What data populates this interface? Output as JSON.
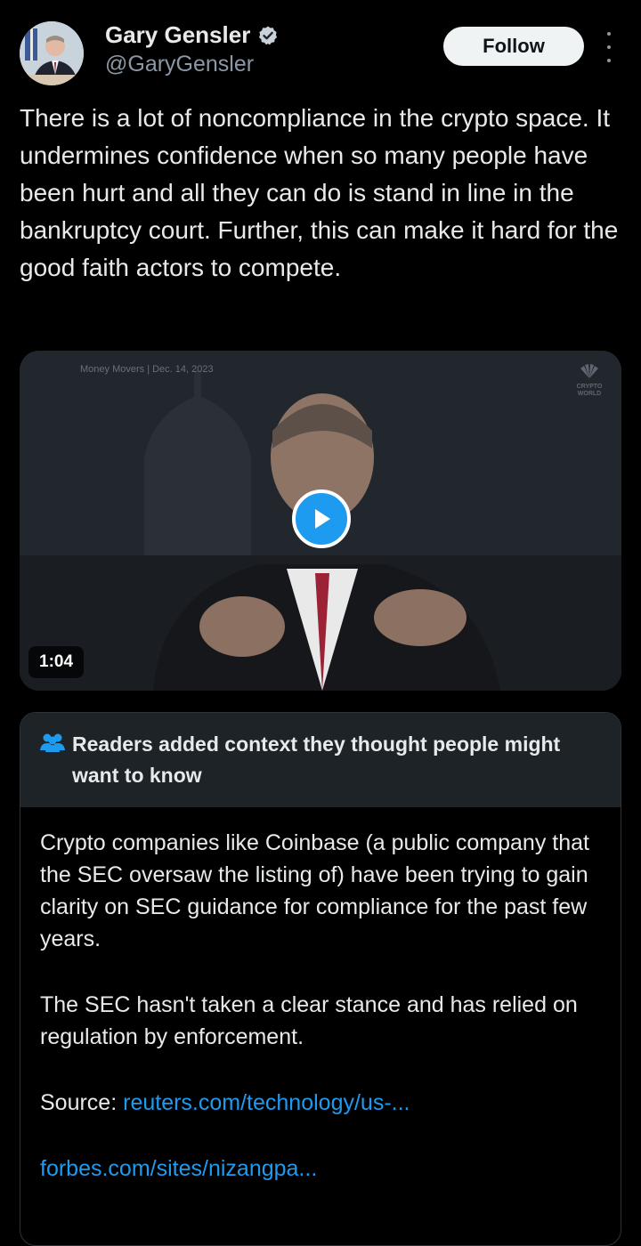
{
  "author": {
    "name": "Gary Gensler",
    "handle": "@GaryGensler",
    "verified_icon": "verified-badge-icon",
    "avatar_icon": "profile-photo"
  },
  "actions": {
    "follow_label": "Follow",
    "more_icon": "more-vertical-icon"
  },
  "tweet": {
    "text": "There is a lot of noncompliance in the crypto space. It undermines confidence when so many people have been hurt and all they can do is stand in line in the bankruptcy court. Further, this can make it hard for the good faith actors to compete."
  },
  "video": {
    "overlay_label": "Money Movers | Dec. 14, 2023",
    "brand_label": "CRYPTO WORLD",
    "duration": "1:04",
    "play_icon": "play-icon"
  },
  "community_note": {
    "icon": "people-icon",
    "title": "Readers added context they thought people might want to know",
    "paragraph1": "Crypto companies like Coinbase (a public company that the SEC oversaw the listing of) have been trying to gain clarity on SEC guidance for compliance for the past few years.",
    "paragraph2": "The SEC hasn't taken a clear stance and has relied on regulation by enforcement.",
    "source_label": "Source:",
    "link1": "reuters.com/technology/us-...",
    "link2": "forbes.com/sites/nizangpa..."
  },
  "colors": {
    "background": "#000000",
    "accent": "#1d9bf0",
    "note_header": "#1e2328",
    "secondary_text": "#8b98a5"
  }
}
